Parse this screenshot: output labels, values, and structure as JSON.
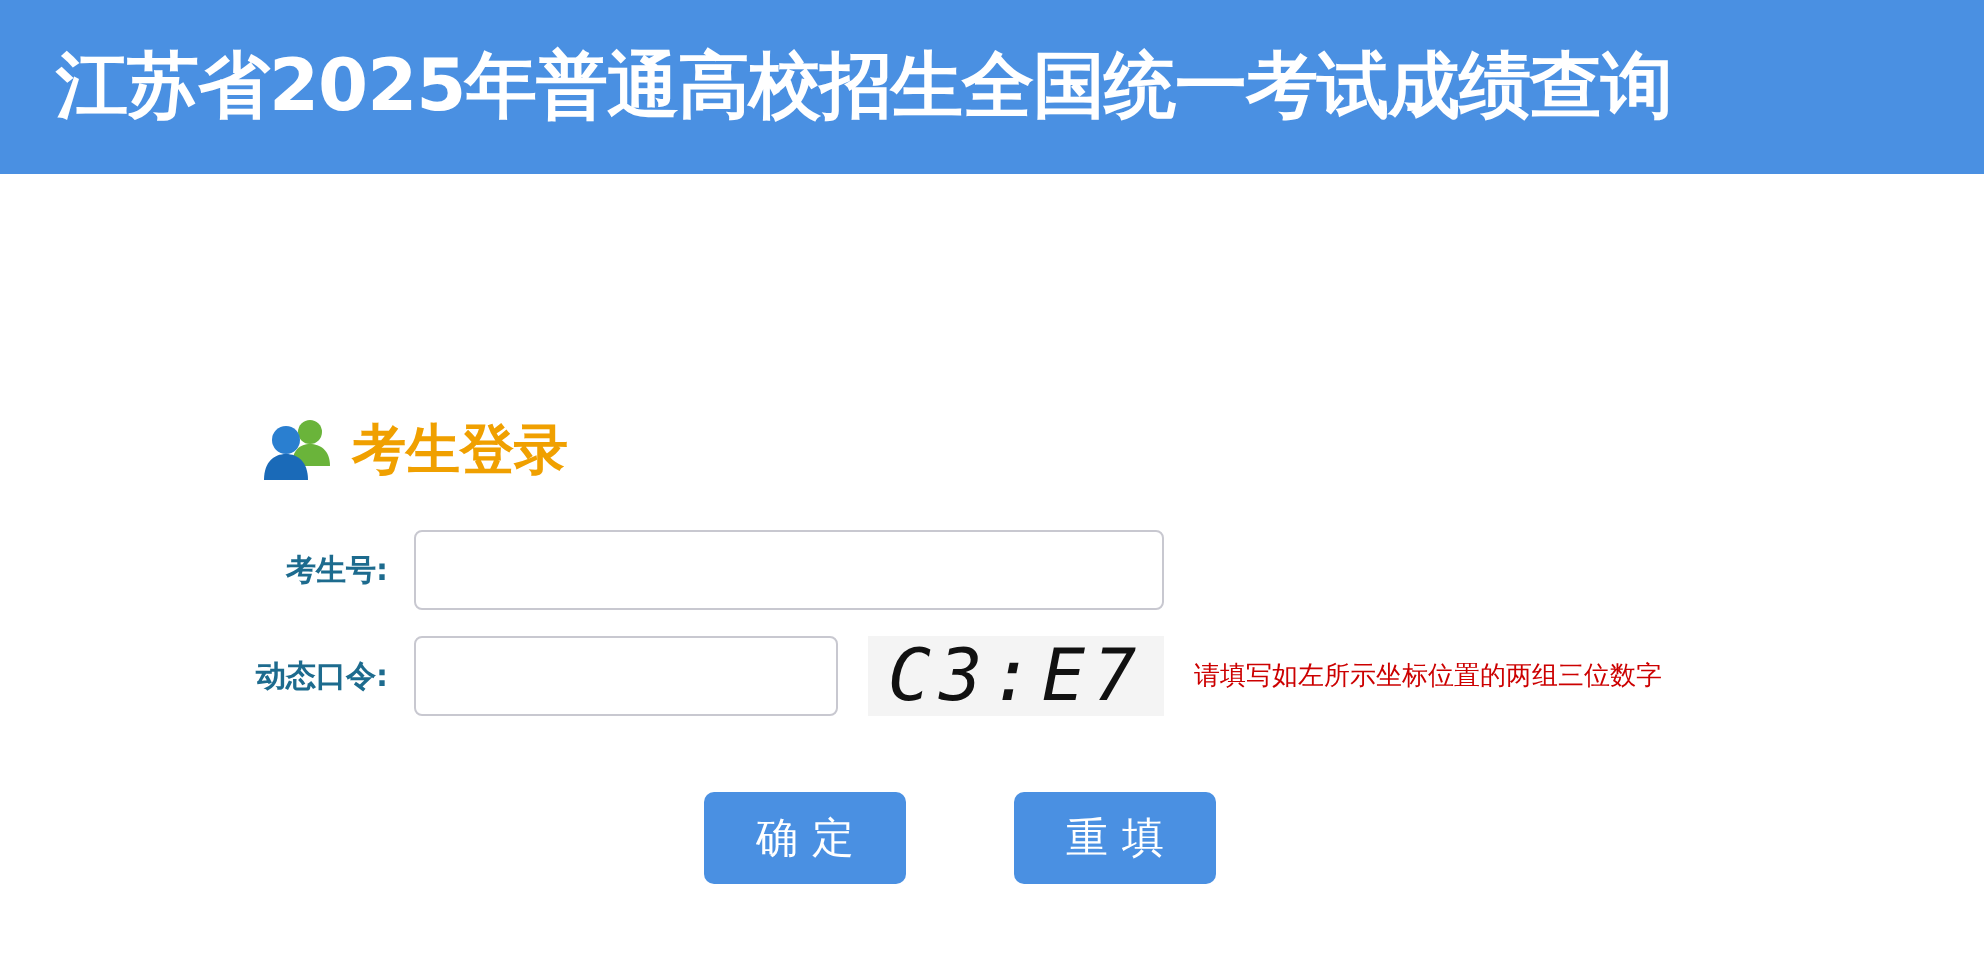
{
  "header": {
    "title": "江苏省2025年普通高校招生全国统一考试成绩查询"
  },
  "login": {
    "title": "考生登录",
    "fields": [
      {
        "label": "考生号:",
        "kind": "wide"
      },
      {
        "label": "动态口令:",
        "kind": "code",
        "code": "C3:E7",
        "hint": "请填写如左所示坐标位置的两组三位数字"
      }
    ],
    "buttons": [
      "确 定",
      "重 填"
    ]
  }
}
